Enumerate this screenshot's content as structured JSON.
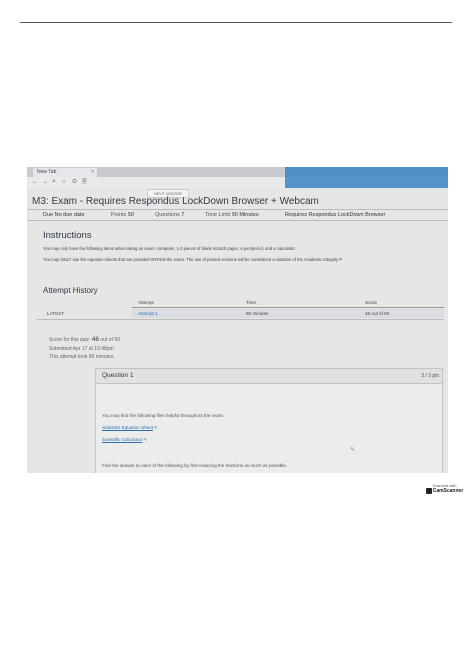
{
  "browser": {
    "tab_title": "New Tab",
    "tab_close": "×",
    "nav": [
      "←",
      "→",
      "×",
      "○",
      "⊙",
      "🗎"
    ]
  },
  "header": {
    "help_center": "HELP CENTER",
    "exam_title": "M3: Exam - Requires Respondus LockDown Browser + Webcam"
  },
  "meta": {
    "due": "Due No due date",
    "points_label": "Points",
    "points_value": "50",
    "questions_label": "Questions",
    "questions_value": "7",
    "time_limit_label": "Time Limit",
    "time_limit_value": "90 Minutes",
    "requires": "Requires Respondus LockDown Browser"
  },
  "instructions": {
    "heading": "Instructions",
    "line1": "You may only have the following items when taking an exam: computer, 1-2 pieces of blank scratch paper, a pen/pencil, and a calculator.",
    "line2": "You may ONLY use the equation sheets that are provided WITHIN the exam. The use of printed versions will be considered a violation of the Academic Integrity P"
  },
  "attempt_history": {
    "heading": "Attempt History",
    "columns": [
      "Attempt",
      "Time",
      "Score"
    ],
    "row": {
      "label": "LATEST",
      "attempt": "Attempt 1",
      "time": "90 minutes",
      "score": "46 out of 50"
    }
  },
  "score_summary": {
    "score_prefix": "Score for this quiz:",
    "score_value": "46",
    "score_suffix": "out of 50",
    "submitted": "Submitted Apr 17 at 10:48pm",
    "duration": "This attempt took 90 minutes."
  },
  "question": {
    "title": "Question 1",
    "points": "3 / 3 pts",
    "intro": "You may find the following files helpful throughout the exam:",
    "link1": "Statistics Equation Sheet",
    "link2": "Scientific Calculator",
    "link_icon": "⇱",
    "prompt": "Find the answer to each of the following by first reducing the fractions as much as possible."
  },
  "scanner": {
    "line1": "Scanned with",
    "brand": "CamScanner"
  },
  "colors": {
    "accent": "#3b84c4",
    "link": "#2a6fb5",
    "title": "#2d3b45"
  }
}
